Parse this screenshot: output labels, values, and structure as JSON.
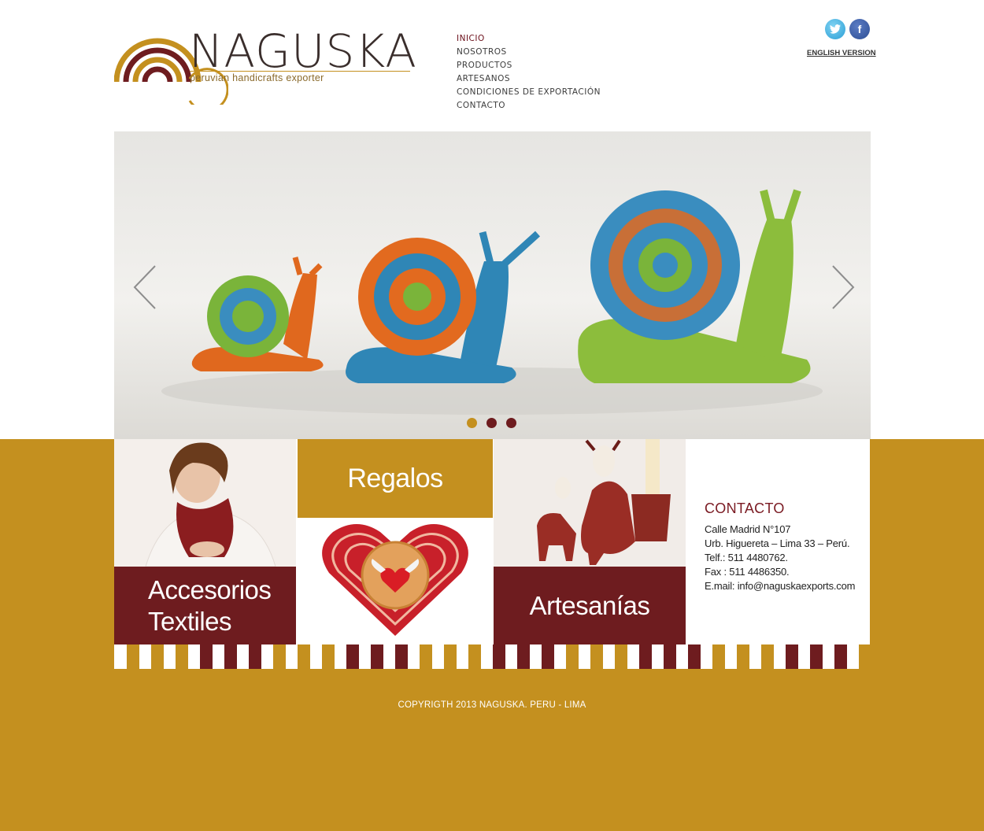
{
  "brand": {
    "name": "NAGUSKA",
    "tagline": "peruvian handicrafts exporter",
    "colors": {
      "gold": "#c4901f",
      "maroon": "#6e1c1f",
      "text": "#3a2e2c"
    }
  },
  "nav": {
    "items": [
      {
        "label": "INICIO",
        "active": true
      },
      {
        "label": "NOSOTROS"
      },
      {
        "label": "PRODUCTOS"
      },
      {
        "label": "ARTESANOS"
      },
      {
        "label": "CONDICIONES DE EXPORTACIÓN"
      },
      {
        "label": "CONTACTO"
      }
    ]
  },
  "social": {
    "twitter_icon": "twitter-icon",
    "facebook_icon": "facebook-icon",
    "facebook_glyph": "f"
  },
  "language_link": "ENGLISH VERSION",
  "slider": {
    "slide_count": 3,
    "active_slide": 1,
    "image": "knitted-snails-photo"
  },
  "tiles": {
    "accesorios": {
      "line1": "Accesorios",
      "line2": "Textiles"
    },
    "regalos": {
      "label": "Regalos"
    },
    "artesanias": {
      "label": "Artesanías"
    },
    "contact": {
      "title": "CONTACTO",
      "address1": "Calle Madrid N°107",
      "address2": "Urb. Higuereta – Lima 33 – Perú.",
      "phone": "Telf.: 511 4480762.",
      "fax": "Fax : 511 4486350.",
      "email": "E.mail: info@naguskaexports.com"
    }
  },
  "footer": {
    "copyright": "COPYRIGTH 2013 NAGUSKA. PERU - LIMA"
  }
}
